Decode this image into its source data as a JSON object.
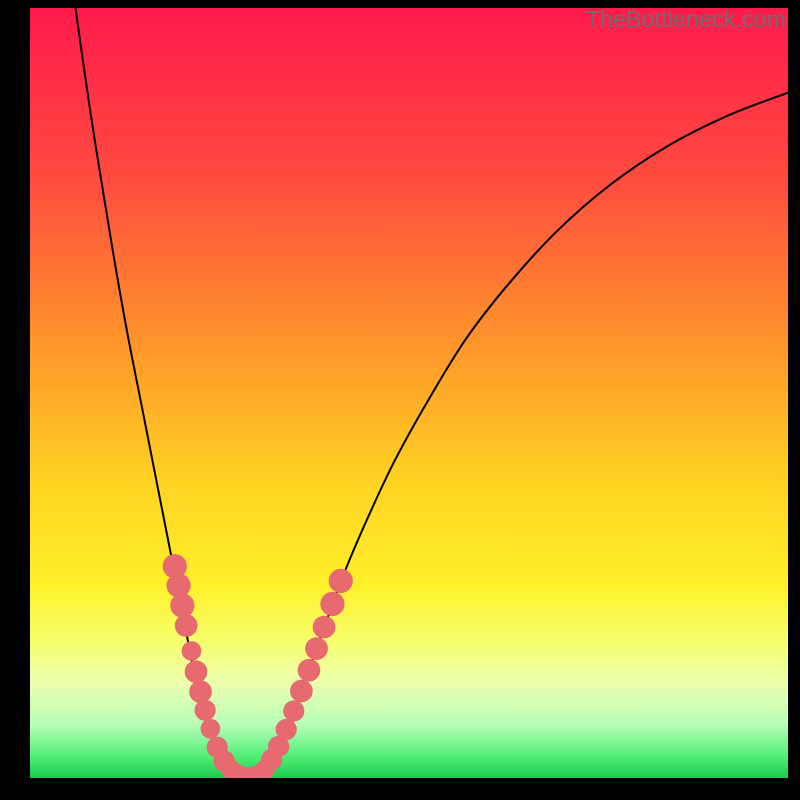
{
  "watermark": "TheBottleneck.com",
  "chart_data": {
    "type": "line",
    "title": "",
    "xlabel": "",
    "ylabel": "",
    "xlim": [
      0,
      100
    ],
    "ylim": [
      0,
      100
    ],
    "gradient_stops": [
      {
        "offset": 0.0,
        "color": "#ff1a4b"
      },
      {
        "offset": 0.22,
        "color": "#ff4b3f"
      },
      {
        "offset": 0.45,
        "color": "#ff9a2a"
      },
      {
        "offset": 0.62,
        "color": "#ffd423"
      },
      {
        "offset": 0.75,
        "color": "#fff02a"
      },
      {
        "offset": 0.82,
        "color": "#f8ff6a"
      },
      {
        "offset": 0.88,
        "color": "#e9ffb0"
      },
      {
        "offset": 0.93,
        "color": "#b8ffb8"
      },
      {
        "offset": 0.97,
        "color": "#55f07a"
      },
      {
        "offset": 1.0,
        "color": "#18cc4e"
      }
    ],
    "series": [
      {
        "name": "left-curve",
        "stroke": "#000000",
        "points": [
          {
            "x": 6.0,
            "y": 100.0
          },
          {
            "x": 7.0,
            "y": 93.0
          },
          {
            "x": 8.2,
            "y": 85.0
          },
          {
            "x": 9.5,
            "y": 77.0
          },
          {
            "x": 11.0,
            "y": 68.0
          },
          {
            "x": 12.8,
            "y": 58.0
          },
          {
            "x": 14.8,
            "y": 48.0
          },
          {
            "x": 16.8,
            "y": 38.0
          },
          {
            "x": 18.4,
            "y": 30.0
          },
          {
            "x": 19.6,
            "y": 24.0
          },
          {
            "x": 20.6,
            "y": 19.0
          },
          {
            "x": 21.6,
            "y": 14.0
          },
          {
            "x": 22.6,
            "y": 10.0
          },
          {
            "x": 23.8,
            "y": 6.0
          },
          {
            "x": 25.0,
            "y": 3.0
          },
          {
            "x": 26.2,
            "y": 1.2
          },
          {
            "x": 27.5,
            "y": 0.3
          },
          {
            "x": 29.0,
            "y": 0.0
          }
        ]
      },
      {
        "name": "right-curve",
        "stroke": "#000000",
        "points": [
          {
            "x": 29.0,
            "y": 0.0
          },
          {
            "x": 30.3,
            "y": 0.3
          },
          {
            "x": 31.6,
            "y": 1.5
          },
          {
            "x": 33.0,
            "y": 4.0
          },
          {
            "x": 34.6,
            "y": 8.0
          },
          {
            "x": 36.4,
            "y": 13.0
          },
          {
            "x": 38.6,
            "y": 19.0
          },
          {
            "x": 41.2,
            "y": 26.0
          },
          {
            "x": 44.2,
            "y": 33.0
          },
          {
            "x": 48.0,
            "y": 41.0
          },
          {
            "x": 52.5,
            "y": 49.0
          },
          {
            "x": 57.5,
            "y": 57.0
          },
          {
            "x": 63.0,
            "y": 64.0
          },
          {
            "x": 69.5,
            "y": 71.0
          },
          {
            "x": 76.5,
            "y": 77.0
          },
          {
            "x": 84.0,
            "y": 82.0
          },
          {
            "x": 92.0,
            "y": 86.0
          },
          {
            "x": 100.0,
            "y": 89.0
          }
        ]
      }
    ],
    "clusters": [
      {
        "name": "left-cluster",
        "color": "#e66a6f",
        "points": [
          {
            "x": 19.1,
            "y": 27.5,
            "r": 1.6
          },
          {
            "x": 19.6,
            "y": 25.0,
            "r": 1.6
          },
          {
            "x": 20.1,
            "y": 22.4,
            "r": 1.6
          },
          {
            "x": 20.6,
            "y": 19.8,
            "r": 1.5
          },
          {
            "x": 21.3,
            "y": 16.5,
            "r": 1.3
          },
          {
            "x": 21.9,
            "y": 13.8,
            "r": 1.5
          },
          {
            "x": 22.5,
            "y": 11.2,
            "r": 1.5
          },
          {
            "x": 23.1,
            "y": 8.8,
            "r": 1.4
          },
          {
            "x": 23.8,
            "y": 6.4,
            "r": 1.3
          },
          {
            "x": 24.7,
            "y": 4.0,
            "r": 1.4
          },
          {
            "x": 25.6,
            "y": 2.2,
            "r": 1.4
          },
          {
            "x": 26.5,
            "y": 1.1,
            "r": 1.3
          },
          {
            "x": 27.4,
            "y": 0.5,
            "r": 1.3
          },
          {
            "x": 28.3,
            "y": 0.2,
            "r": 1.3
          },
          {
            "x": 29.2,
            "y": 0.2,
            "r": 1.3
          }
        ]
      },
      {
        "name": "right-cluster",
        "color": "#e66a6f",
        "points": [
          {
            "x": 30.1,
            "y": 0.4,
            "r": 1.3
          },
          {
            "x": 31.0,
            "y": 1.1,
            "r": 1.3
          },
          {
            "x": 31.9,
            "y": 2.4,
            "r": 1.4
          },
          {
            "x": 32.8,
            "y": 4.1,
            "r": 1.4
          },
          {
            "x": 33.8,
            "y": 6.3,
            "r": 1.4
          },
          {
            "x": 34.8,
            "y": 8.7,
            "r": 1.4
          },
          {
            "x": 35.8,
            "y": 11.3,
            "r": 1.5
          },
          {
            "x": 36.8,
            "y": 14.0,
            "r": 1.5
          },
          {
            "x": 37.8,
            "y": 16.8,
            "r": 1.5
          },
          {
            "x": 38.8,
            "y": 19.6,
            "r": 1.5
          },
          {
            "x": 39.9,
            "y": 22.6,
            "r": 1.6
          },
          {
            "x": 41.0,
            "y": 25.6,
            "r": 1.6
          }
        ]
      }
    ]
  }
}
